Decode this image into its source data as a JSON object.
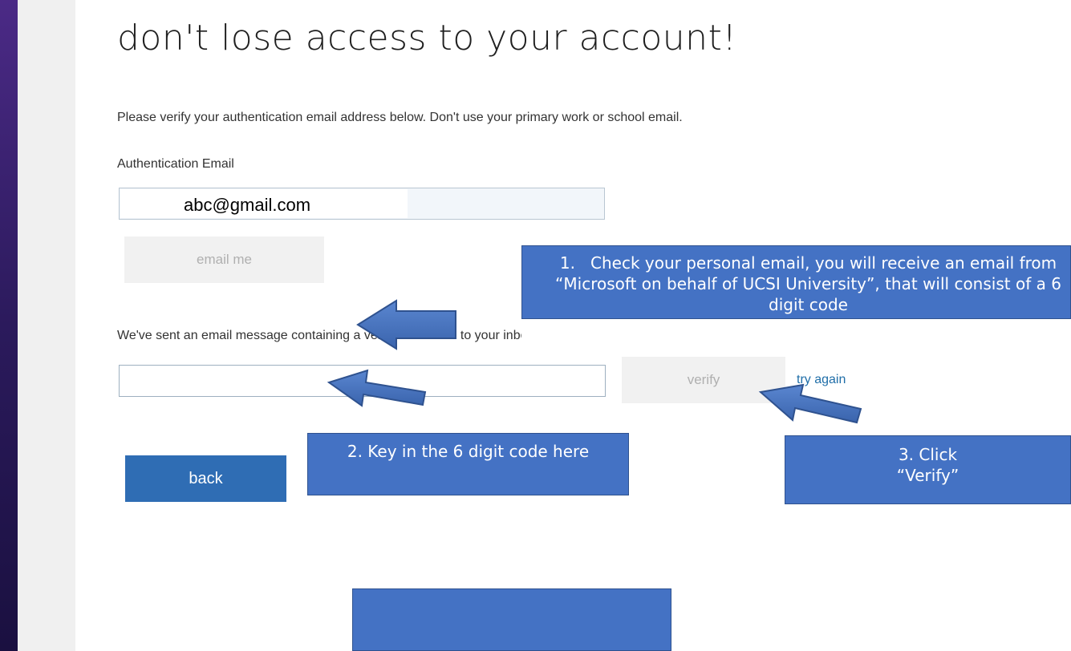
{
  "page": {
    "title": "don't lose access to your account!",
    "instruction": "Please verify your authentication email address below. Don't use your primary work or school email.",
    "email_label": "Authentication Email",
    "email_value": "abc@gmail.com",
    "email_me_label": "email me",
    "sent_message": "We've sent an email message containing a verification code to your inbox.",
    "verify_label": "verify",
    "try_again_label": "try again",
    "back_label": "back"
  },
  "annotations": {
    "step1_prefix": "1.",
    "step1_text": "Check your personal email, you will receive an email from “Microsoft on behalf of UCSI University”, that will consist of a 6 digit code",
    "step2_text": "2. Key in the 6 digit code here",
    "step3_line1": "3. Click",
    "step3_line2": "“Verify”"
  },
  "colors": {
    "primary_button": "#2f6db4",
    "callout_fill": "#4472c4",
    "link": "#1f6ea8",
    "disabled_button": "#f1f1f1"
  }
}
